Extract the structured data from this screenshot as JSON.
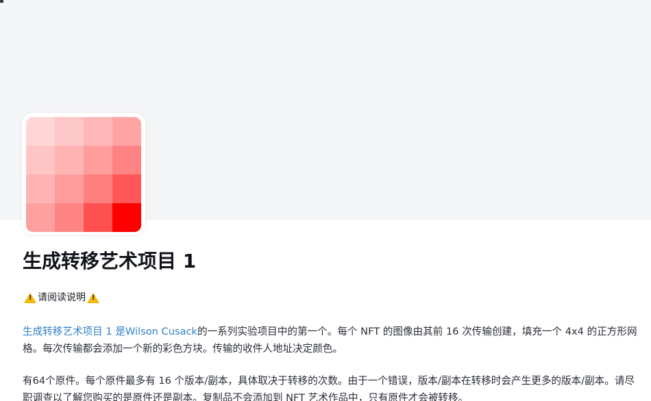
{
  "colors": {
    "banner": "#f4f5f7",
    "link": "#2f80c8",
    "grid": [
      [
        "#ffd6d6",
        "#ffc8c8",
        "#ffb8b8",
        "#ffa4a4"
      ],
      [
        "#ffc4c4",
        "#ffb4b4",
        "#ff9d9d",
        "#ff8383"
      ],
      [
        "#ffb3b3",
        "#ff9d9d",
        "#ff7f7f",
        "#ff5757"
      ],
      [
        "#ffa0a0",
        "#ff8585",
        "#ff5050",
        "#ff0000"
      ]
    ]
  },
  "project": {
    "title": "生成转移艺术项目 1",
    "notice": "请阅读说明",
    "notice_icon": "warning-icon",
    "p1_link": "生成转移艺术项目 1 是Wilson Cusack",
    "p1_text": "的一系列实验项目中的第一个。每个 NFT 的图像由其前 16 次传输创建，填充一个 4x4 的正方形网格。每次传输都会添加一个新的彩色方块。传输的收件人地址决定颜色。",
    "p2_text": "有64个原件。每个原件最多有 16 个版本/副本，具体取决于转移的次数。由于一个错误，版本/副本在转移时会产生更多的版本/副本。请尽职调查以了解您购买的是原件还是副本。复制品不会添加到 NFT 艺术作品中，只有原件才会被转移。"
  }
}
